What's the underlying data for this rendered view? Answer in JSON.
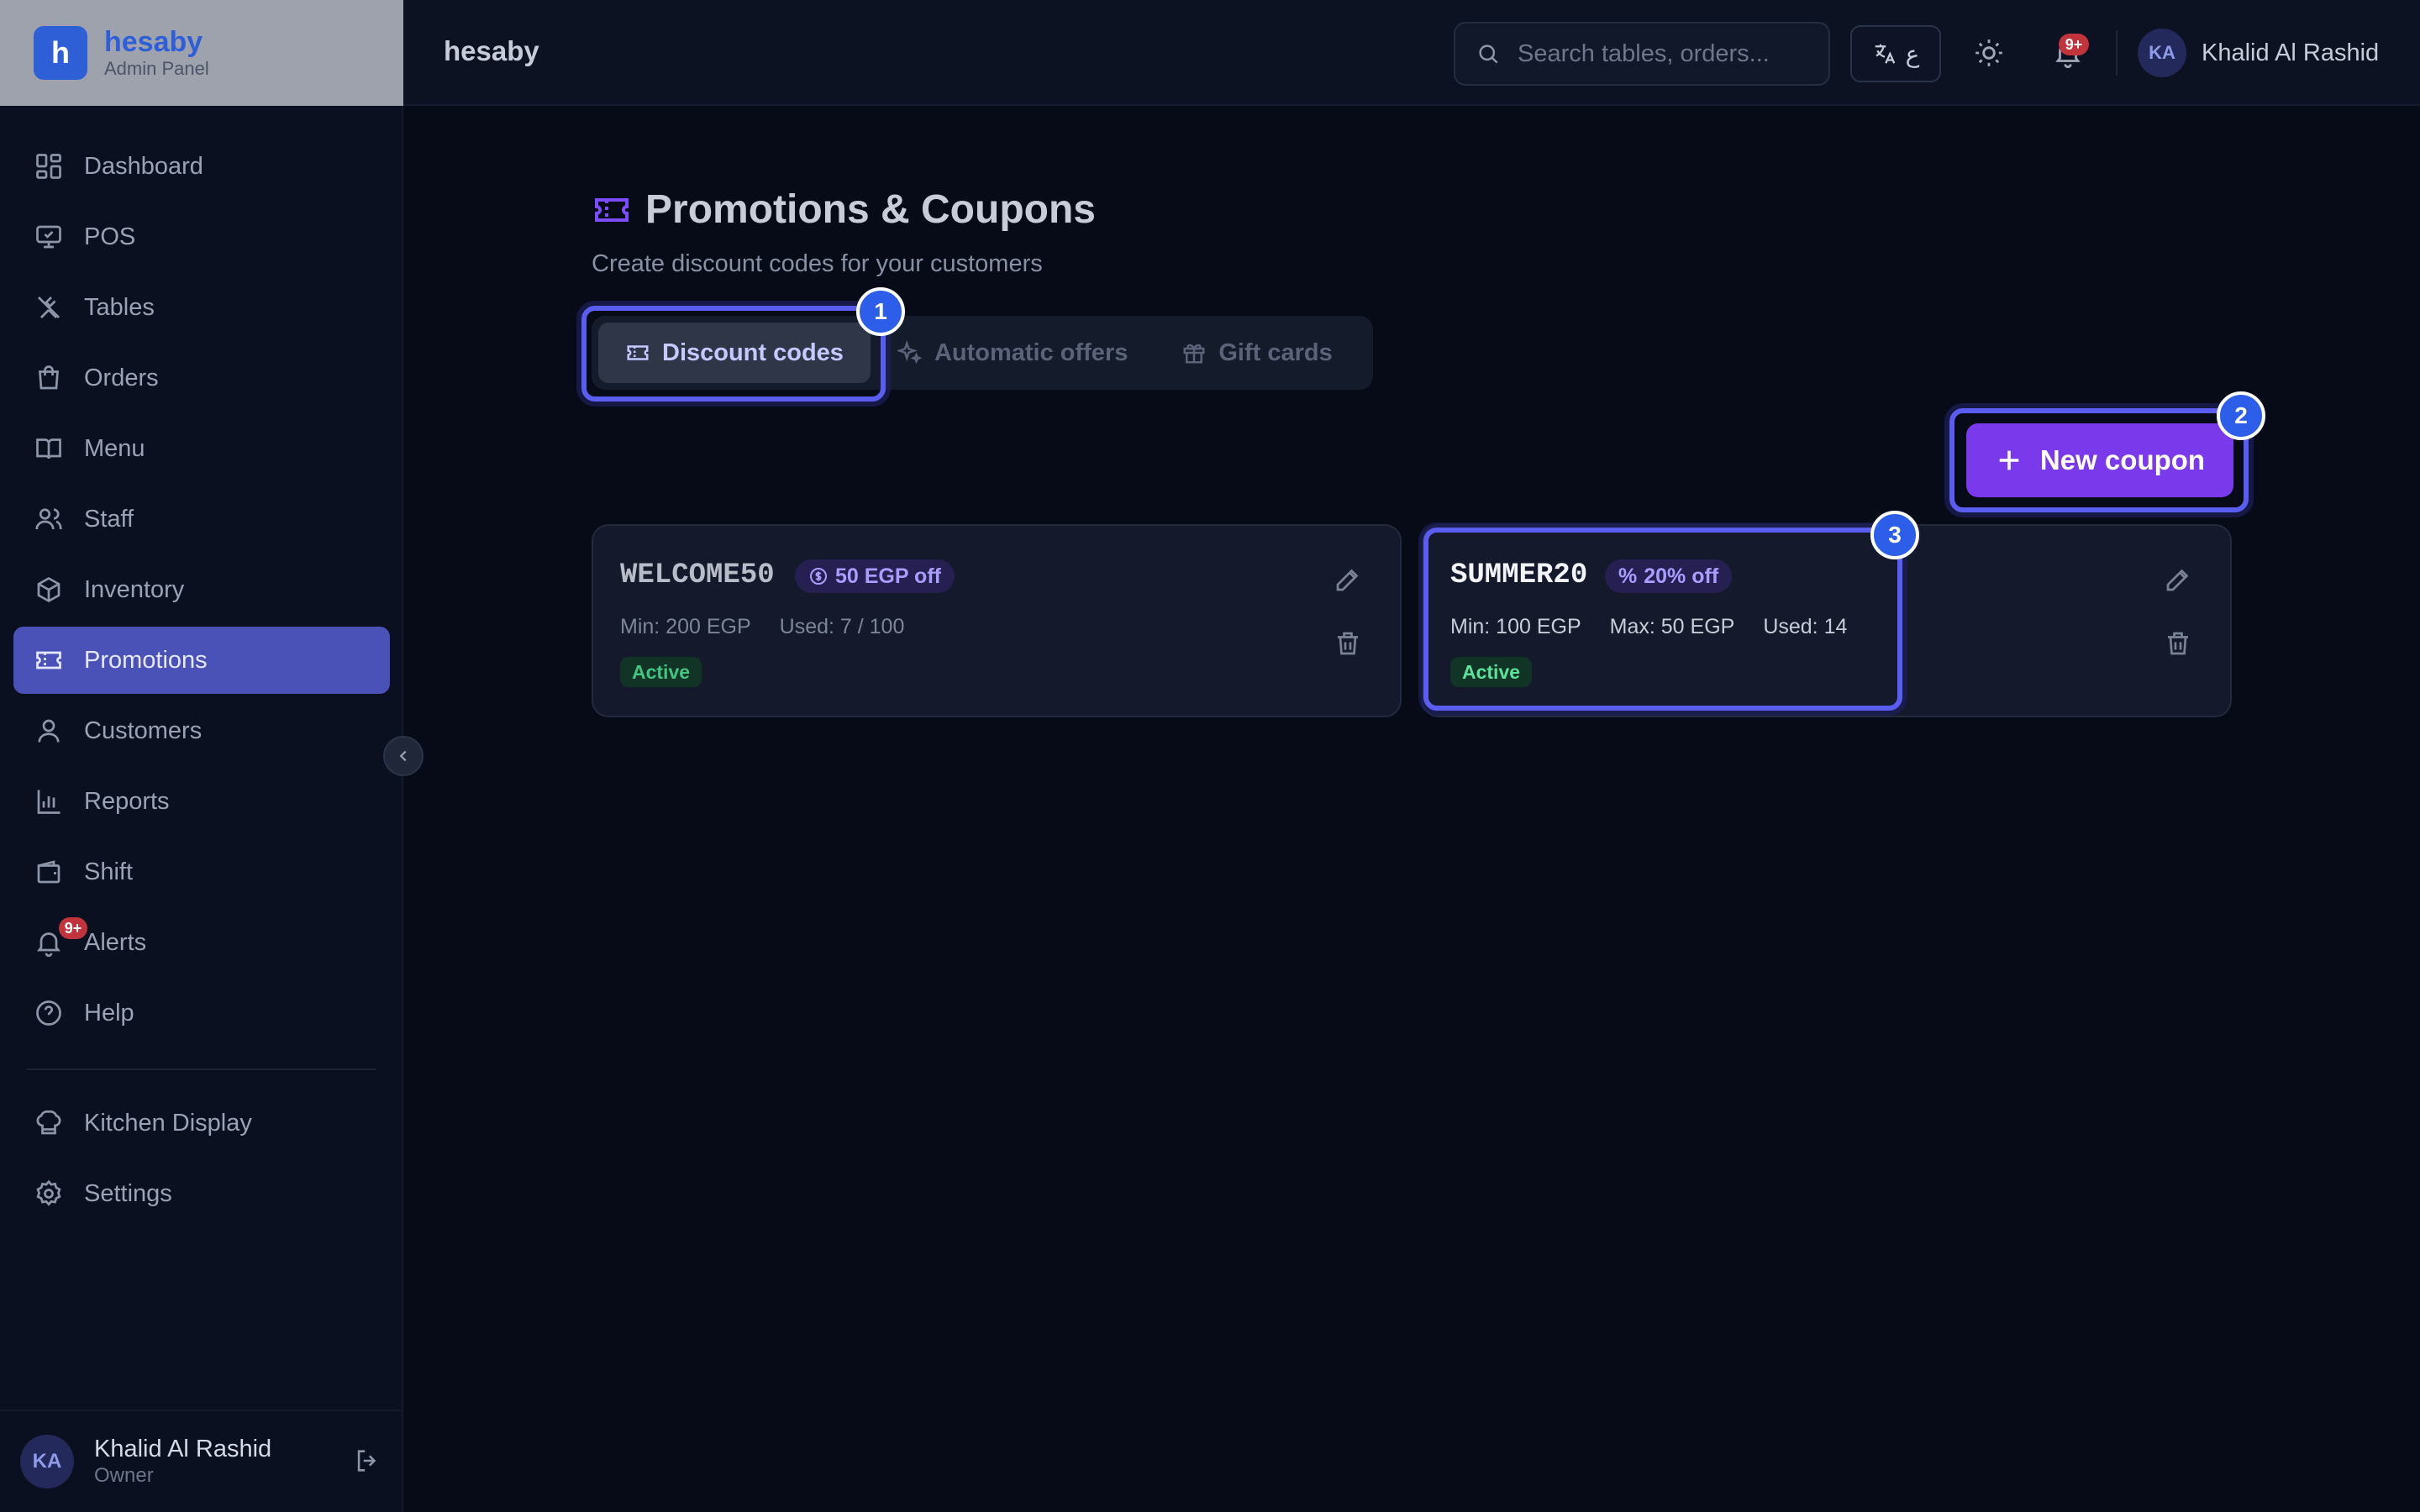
{
  "brand": {
    "logo_letter": "h",
    "name": "hesaby",
    "subtitle": "Admin Panel"
  },
  "topbar": {
    "title": "hesaby",
    "search_placeholder": "Search tables, orders...",
    "lang_label": "ع",
    "notification_badge": "9+",
    "user_initials": "KA",
    "user_name": "Khalid Al Rashid"
  },
  "sidebar": {
    "items": [
      {
        "label": "Dashboard",
        "icon": "dashboard-icon"
      },
      {
        "label": "POS",
        "icon": "monitor-icon"
      },
      {
        "label": "Tables",
        "icon": "utensils-icon"
      },
      {
        "label": "Orders",
        "icon": "shopping-bag-icon"
      },
      {
        "label": "Menu",
        "icon": "book-open-icon"
      },
      {
        "label": "Staff",
        "icon": "users-icon"
      },
      {
        "label": "Inventory",
        "icon": "box-icon"
      },
      {
        "label": "Promotions",
        "icon": "ticket-icon",
        "active": true
      },
      {
        "label": "Customers",
        "icon": "user-icon"
      },
      {
        "label": "Reports",
        "icon": "bar-chart-icon"
      },
      {
        "label": "Shift",
        "icon": "wallet-icon"
      },
      {
        "label": "Alerts",
        "icon": "bell-icon",
        "badge": "9+"
      },
      {
        "label": "Help",
        "icon": "help-circle-icon"
      }
    ],
    "secondary": [
      {
        "label": "Kitchen Display",
        "icon": "chef-hat-icon"
      },
      {
        "label": "Settings",
        "icon": "gear-icon"
      }
    ],
    "footer": {
      "initials": "KA",
      "name": "Khalid Al Rashid",
      "role": "Owner"
    }
  },
  "page": {
    "title": "Promotions & Coupons",
    "subtitle": "Create discount codes for your customers",
    "tabs": [
      {
        "label": "Discount codes",
        "active": true
      },
      {
        "label": "Automatic offers"
      },
      {
        "label": "Gift cards"
      }
    ],
    "new_button": "New coupon",
    "markers": [
      "1",
      "2",
      "3"
    ]
  },
  "coupons": [
    {
      "code": "WELCOME50",
      "badge": "50 EGP off",
      "min": "Min: 200 EGP",
      "used": "Used: 7 / 100",
      "status": "Active"
    },
    {
      "code": "SUMMER20",
      "badge": "20% off",
      "min": "Min: 100 EGP",
      "max": "Max: 50 EGP",
      "used": "Used: 14",
      "status": "Active"
    }
  ],
  "colors": {
    "accent": "#7a39ea",
    "active_nav": "#4a52b8",
    "highlight": "#5b5df0",
    "marker": "#2c5ee9",
    "status_active": "#43c581",
    "badge_red": "#c2343b"
  }
}
